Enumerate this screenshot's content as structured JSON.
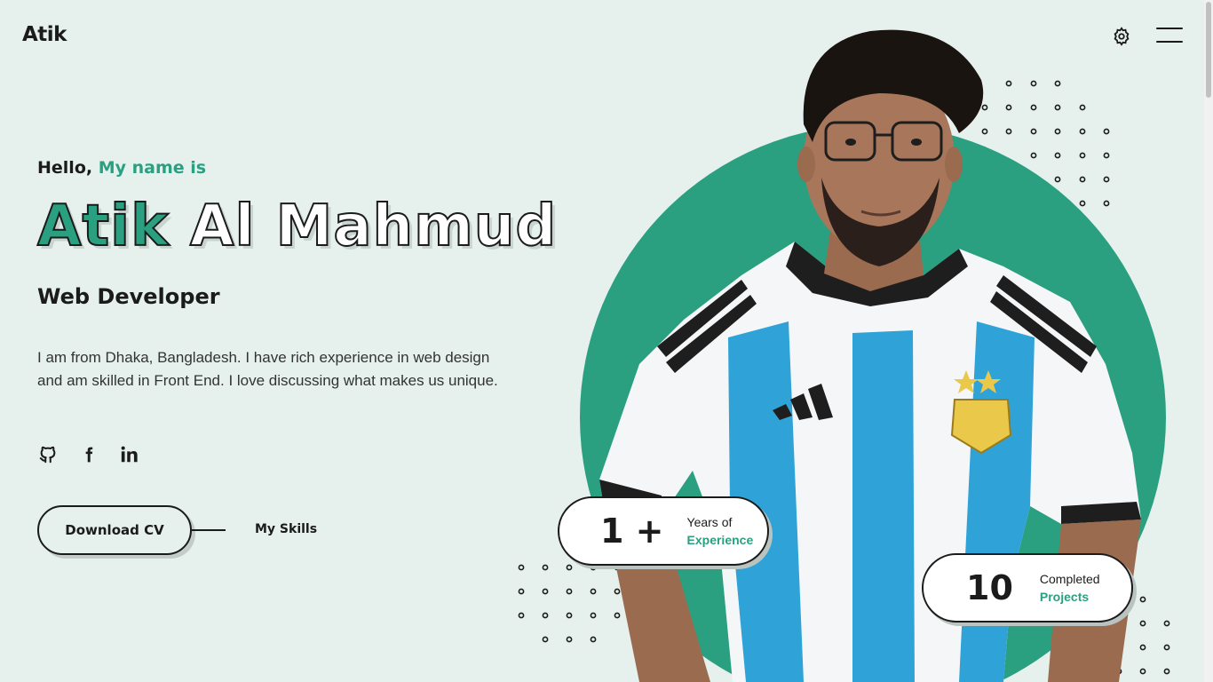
{
  "header": {
    "logo": "Atik",
    "settings_icon": "gear-icon",
    "menu_icon": "hamburger-icon"
  },
  "hero": {
    "greeting_plain": "Hello,",
    "greeting_accent": "My name is",
    "first_name": "Atik",
    "last_name": "Al Mahmud",
    "role": "Web Developer",
    "bio": "I am from Dhaka, Bangladesh. I have rich experience in web design and am skilled in Front End. I love discussing what makes us unique.",
    "socials": [
      {
        "icon": "github-icon"
      },
      {
        "icon": "facebook-icon"
      },
      {
        "icon": "linkedin-icon"
      }
    ],
    "download_label": "Download CV",
    "skills_label": "My Skills"
  },
  "stats": {
    "experience": {
      "number": "1 +",
      "label_top": "Years of",
      "label_bottom": "Experience"
    },
    "projects": {
      "number": "10",
      "label_top": "Completed",
      "label_bottom": "Projects"
    }
  },
  "colors": {
    "accent": "#2aa080",
    "background": "#e6f1ee",
    "text": "#1b1b1b"
  }
}
